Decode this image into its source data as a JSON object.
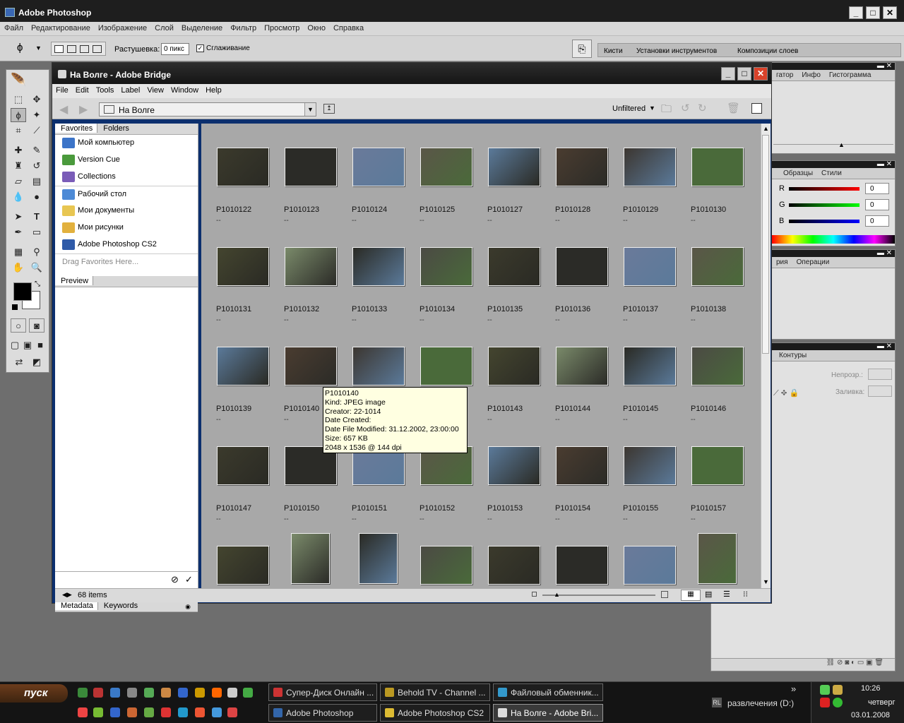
{
  "photoshop": {
    "title": "Adobe Photoshop",
    "menu": [
      "Файл",
      "Редактирование",
      "Изображение",
      "Слой",
      "Выделение",
      "Фильтр",
      "Просмотр",
      "Окно",
      "Справка"
    ],
    "options": {
      "feather_label": "Растушевка:",
      "feather_value": "0 пикс",
      "antialias_label": "Сглаживание"
    },
    "palette_well_tabs": [
      "Кисти",
      "Установки инструментов",
      "Композиции слоев"
    ],
    "palettes": {
      "navigator_tabs": [
        "гатор",
        "Инфо",
        "Гистограмма"
      ],
      "color_tabs": [
        "Образцы",
        "Стили"
      ],
      "color": [
        {
          "ch": "R",
          "val": "0"
        },
        {
          "ch": "G",
          "val": "0"
        },
        {
          "ch": "B",
          "val": "0"
        }
      ],
      "history_tabs": [
        "рия",
        "Операции"
      ],
      "layers_tabs": [
        "Контуры"
      ],
      "opacity_label": "Непрозр.:",
      "fill_label": "Заливка:"
    }
  },
  "bridge": {
    "title": "На Волге - Adobe Bridge",
    "menu": [
      "File",
      "Edit",
      "Tools",
      "Label",
      "View",
      "Window",
      "Help"
    ],
    "path": "На Волге",
    "filter": "Unfiltered",
    "left_tabs": [
      "Favorites",
      "Folders"
    ],
    "favorites": [
      "Мой компьютер",
      "Version Cue",
      "Collections",
      "Рабочий стол",
      "Мои документы",
      "Мои рисунки",
      "Adobe Photoshop CS2"
    ],
    "drag_hint": "Drag Favorites Here...",
    "preview_tab": "Preview",
    "meta_tabs": [
      "Metadata",
      "Keywords"
    ],
    "status": "68 items",
    "thumbnails": [
      {
        "name": "P1010122",
        "sub": "--"
      },
      {
        "name": "P1010123",
        "sub": "--"
      },
      {
        "name": "P1010124",
        "sub": "--"
      },
      {
        "name": "P1010125",
        "sub": "--"
      },
      {
        "name": "P1010127",
        "sub": "--"
      },
      {
        "name": "P1010128",
        "sub": "--"
      },
      {
        "name": "P1010129",
        "sub": "--"
      },
      {
        "name": "P1010130",
        "sub": "--"
      },
      {
        "name": "P1010131",
        "sub": "--"
      },
      {
        "name": "P1010132",
        "sub": "--"
      },
      {
        "name": "P1010133",
        "sub": "--"
      },
      {
        "name": "P1010134",
        "sub": "--"
      },
      {
        "name": "P1010135",
        "sub": "--"
      },
      {
        "name": "P1010136",
        "sub": "--"
      },
      {
        "name": "P1010137",
        "sub": "--"
      },
      {
        "name": "P1010138",
        "sub": "--"
      },
      {
        "name": "P1010139",
        "sub": "--"
      },
      {
        "name": "P1010140",
        "sub": "--"
      },
      {
        "name": "",
        "sub": ""
      },
      {
        "name": "",
        "sub": ""
      },
      {
        "name": "P1010143",
        "sub": "--"
      },
      {
        "name": "P1010144",
        "sub": "--"
      },
      {
        "name": "P1010145",
        "sub": "--"
      },
      {
        "name": "P1010146",
        "sub": "--"
      },
      {
        "name": "P1010147",
        "sub": "--"
      },
      {
        "name": "P1010150",
        "sub": "--"
      },
      {
        "name": "P1010151",
        "sub": "--"
      },
      {
        "name": "P1010152",
        "sub": "--"
      },
      {
        "name": "P1010153",
        "sub": "--"
      },
      {
        "name": "P1010154",
        "sub": "--"
      },
      {
        "name": "P1010155",
        "sub": "--"
      },
      {
        "name": "P1010157",
        "sub": "--"
      },
      {
        "name": "",
        "sub": ""
      },
      {
        "name": "",
        "sub": ""
      },
      {
        "name": "",
        "sub": ""
      },
      {
        "name": "",
        "sub": ""
      },
      {
        "name": "",
        "sub": ""
      },
      {
        "name": "",
        "sub": ""
      },
      {
        "name": "",
        "sub": ""
      },
      {
        "name": "",
        "sub": ""
      }
    ],
    "tooltip": [
      "P1010140",
      "Kind: JPEG image",
      "Creator: 22-1014",
      "Date Created:",
      "Date File Modified: 31.12.2002, 23:00:00",
      "Size: 657 KB",
      "2048 x 1536 @ 144 dpi"
    ]
  },
  "taskbar": {
    "start": "пуск",
    "row1": [
      "Супер-Диск Онлайн ...",
      "Behold TV - Channel ...",
      "Файловый обменник..."
    ],
    "row2": [
      "Adobe Photoshop",
      "Adobe Photoshop CS2",
      "На Волге - Adobe Bri..."
    ],
    "lang": "RL",
    "drive": "развлечения (D:)",
    "time": "10:26",
    "day": "четверг",
    "date": "03.01.2008",
    "expand": "»"
  },
  "colors": {
    "bridge_title": "#1a1a1a",
    "content_bg": "#a8a8a8",
    "close_red": "#d9422a"
  }
}
